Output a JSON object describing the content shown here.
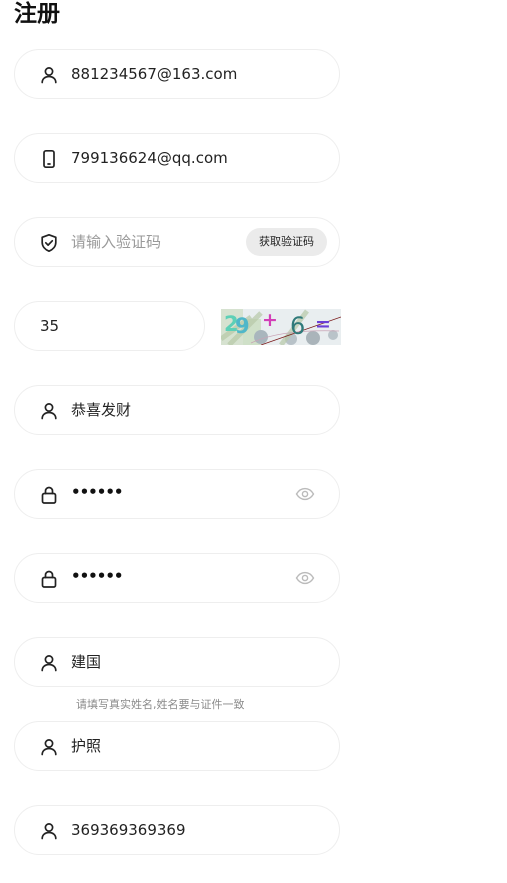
{
  "page": {
    "title": "注册"
  },
  "form": {
    "username": {
      "value": "881234567@163.com",
      "icon": "user-icon"
    },
    "phone": {
      "value": "799136624@qq.com",
      "icon": "phone-icon"
    },
    "verify_code": {
      "placeholder": "请输入验证码",
      "icon": "shield-check-icon",
      "button_label": "获取验证码"
    },
    "captcha": {
      "value": "35",
      "image_glyphs": "29+6="
    },
    "nickname": {
      "value": "恭喜发财",
      "icon": "user-icon"
    },
    "password": {
      "value": "••••••",
      "icon": "lock-icon",
      "toggle_icon": "eye-icon"
    },
    "confirm_password": {
      "value": "••••••",
      "icon": "lock-icon",
      "toggle_icon": "eye-icon"
    },
    "real_name": {
      "value": "建国",
      "icon": "user-icon",
      "hint": "请填写真实姓名,姓名要与证件一致"
    },
    "id_type": {
      "value": "护照",
      "icon": "user-icon"
    },
    "id_number": {
      "value": "369369369369",
      "icon": "user-icon"
    }
  },
  "colors": {
    "border": "#eeeeee",
    "placeholder": "#9a9a9a",
    "button_bg": "#ebebeb",
    "icon": "#222222",
    "eye_icon": "#bbbbbb"
  }
}
